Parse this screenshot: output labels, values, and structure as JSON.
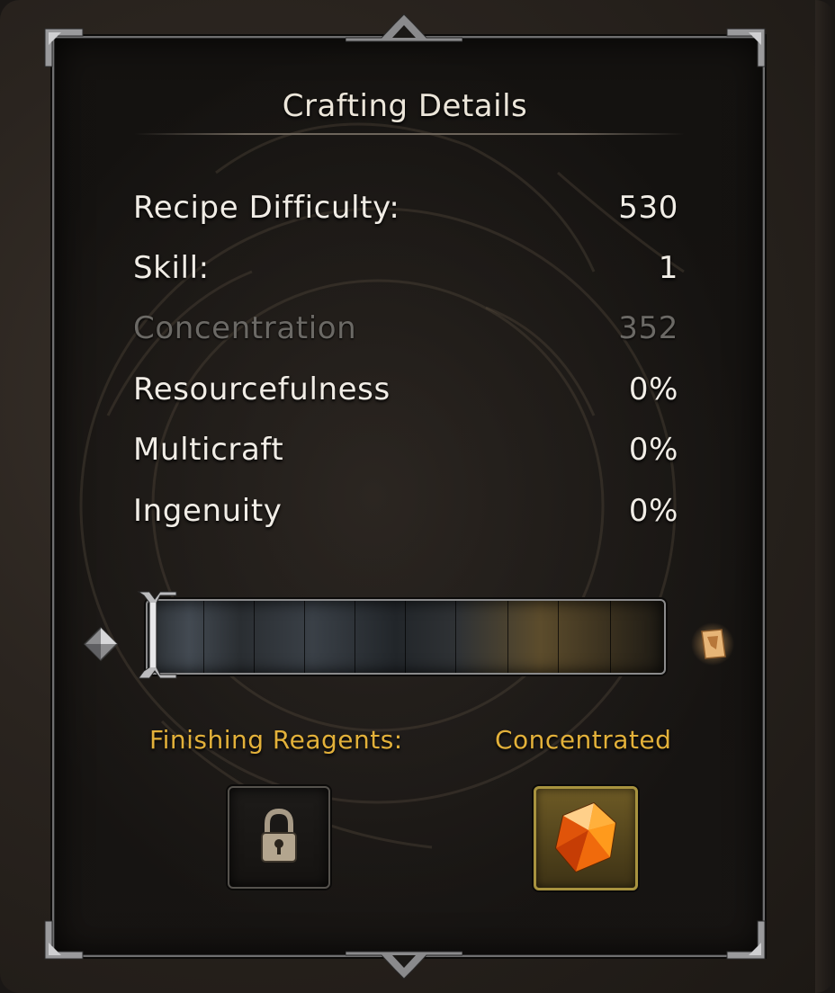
{
  "panel": {
    "title": "Crafting Details"
  },
  "stats": [
    {
      "label": "Recipe Difficulty:",
      "value": "530",
      "dimmed": false
    },
    {
      "label": "Skill:",
      "value": "1",
      "dimmed": false
    },
    {
      "label": "Concentration",
      "value": "352",
      "dimmed": true
    },
    {
      "label": "Resourcefulness",
      "value": "0%",
      "dimmed": false
    },
    {
      "label": "Multicraft",
      "value": "0%",
      "dimmed": false
    },
    {
      "label": "Ingenuity",
      "value": "0%",
      "dimmed": false
    }
  ],
  "quality_bar": {
    "segments": 10,
    "left_icon": "silver-diamond-icon",
    "right_icon": "quality-rank-icon"
  },
  "reagents": {
    "finishing_label": "Finishing Reagents:",
    "concentrated_label": "Concentrated",
    "finishing_slot_icon": "padlock-icon",
    "concentrated_slot_icon": "orange-crystal-icon"
  },
  "colors": {
    "title_text": "#ece6da",
    "stat_text": "#f1ede6",
    "dim_text": "#6b6965",
    "gold_label": "#e3b13a",
    "frame": "#6f6f70"
  }
}
